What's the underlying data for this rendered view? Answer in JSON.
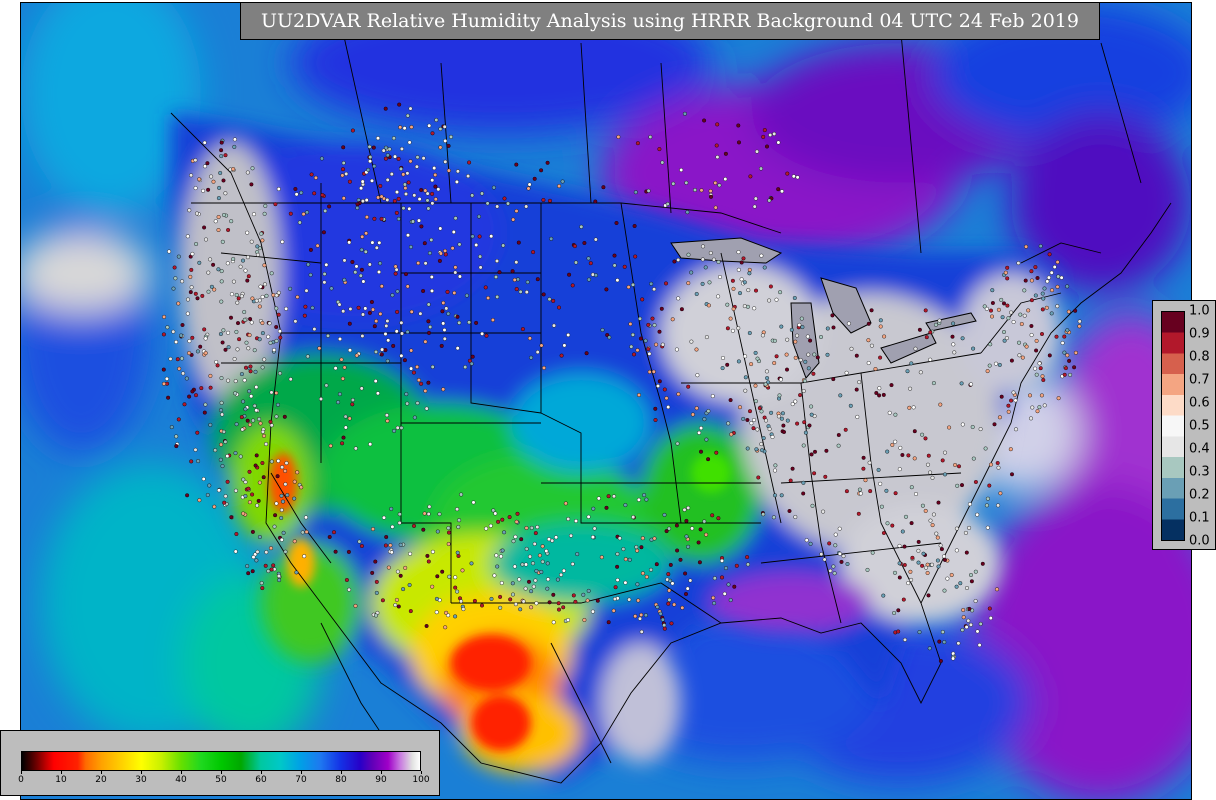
{
  "title": "UU2DVAR Relative Humidity Analysis using HRRR Background 04 UTC 24 Feb 2019",
  "rh_colorbar": {
    "ticks": [
      "0",
      "10",
      "20",
      "30",
      "40",
      "50",
      "60",
      "70",
      "80",
      "90",
      "100"
    ],
    "min": 0,
    "max": 100,
    "stops": [
      {
        "v": 0,
        "c": "#000000"
      },
      {
        "v": 2,
        "c": "#3a0000"
      },
      {
        "v": 4,
        "c": "#7a0000"
      },
      {
        "v": 6,
        "c": "#c00000"
      },
      {
        "v": 8,
        "c": "#ff0000"
      },
      {
        "v": 14,
        "c": "#ff2200"
      },
      {
        "v": 16,
        "c": "#ff6a00"
      },
      {
        "v": 20,
        "c": "#ffa200"
      },
      {
        "v": 25,
        "c": "#ffd000"
      },
      {
        "v": 30,
        "c": "#ffff00"
      },
      {
        "v": 35,
        "c": "#c8f000"
      },
      {
        "v": 40,
        "c": "#66e000"
      },
      {
        "v": 45,
        "c": "#1fd81f"
      },
      {
        "v": 50,
        "c": "#00c800"
      },
      {
        "v": 55,
        "c": "#00a800"
      },
      {
        "v": 60,
        "c": "#00c8a0"
      },
      {
        "v": 65,
        "c": "#00c8c8"
      },
      {
        "v": 70,
        "c": "#00a0e6"
      },
      {
        "v": 75,
        "c": "#1e78f0"
      },
      {
        "v": 80,
        "c": "#1432e6"
      },
      {
        "v": 85,
        "c": "#2800c8"
      },
      {
        "v": 88,
        "c": "#6000b8"
      },
      {
        "v": 92,
        "c": "#a000c8"
      },
      {
        "v": 95,
        "c": "#c878e0"
      },
      {
        "v": 98,
        "c": "#e0e0e0"
      },
      {
        "v": 100,
        "c": "#ffffff"
      }
    ]
  },
  "ratio_colorbar": {
    "ticks": [
      "1.0",
      "0.9",
      "0.8",
      "0.7",
      "0.6",
      "0.5",
      "0.4",
      "0.3",
      "0.2",
      "0.1",
      "0.0"
    ],
    "colors": [
      "#67001f",
      "#b2182b",
      "#d6604d",
      "#f4a582",
      "#fddbc7",
      "#f7f7f7",
      "#e6e6e6",
      "#a8c8c0",
      "#6a9fb5",
      "#2c6fa0",
      "#053061"
    ]
  },
  "colors": {
    "frame": "#000000",
    "panel": "#bdbdbd",
    "title_bg": "#808080",
    "title_text": "#ffffff",
    "ocean": "#1a7fd6"
  }
}
